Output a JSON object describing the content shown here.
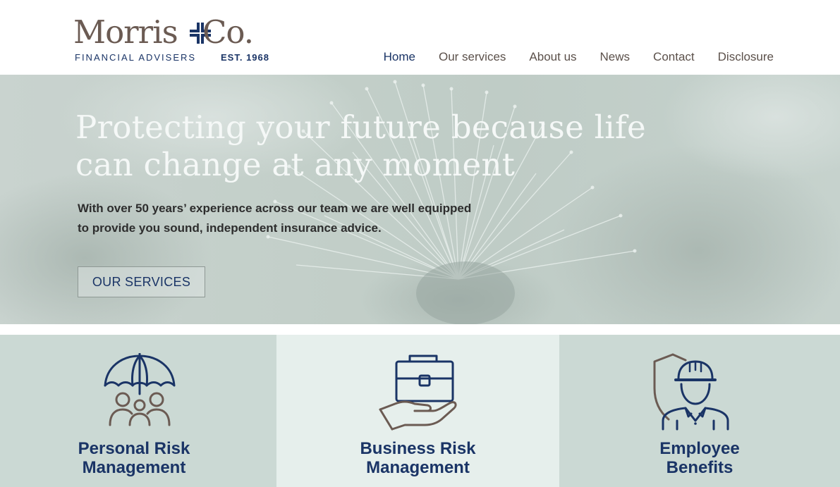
{
  "logo": {
    "left_word": "Morris",
    "right_word": "Co.",
    "tagline_left": "FINANCIAL ADVISERS",
    "tagline_right": "EST. 1968"
  },
  "nav": {
    "items": [
      {
        "label": "Home",
        "active": true
      },
      {
        "label": "Our services",
        "active": false
      },
      {
        "label": "About us",
        "active": false
      },
      {
        "label": "News",
        "active": false
      },
      {
        "label": "Contact",
        "active": false
      },
      {
        "label": "Disclosure",
        "active": false
      }
    ]
  },
  "hero": {
    "title_line1": "Protecting your future because life",
    "title_line2": "can change at any moment",
    "subtitle_line1": "With over 50 years’ experience across our team we are well equipped",
    "subtitle_line2": "to provide you sound, independent insurance advice.",
    "button_label": "OUR SERVICES"
  },
  "cards": [
    {
      "line1": "Personal Risk",
      "line2": "Management",
      "icon": "umbrella-family-icon"
    },
    {
      "line1": "Business Risk",
      "line2": "Management",
      "icon": "briefcase-hand-icon"
    },
    {
      "line1": "Employee",
      "line2": "Benefits",
      "icon": "worker-shield-icon"
    }
  ],
  "colors": {
    "brand_navy": "#1a3466",
    "brand_brown": "#6b5b53",
    "card_green": "#cbd9d4",
    "card_light": "#e6efec"
  }
}
